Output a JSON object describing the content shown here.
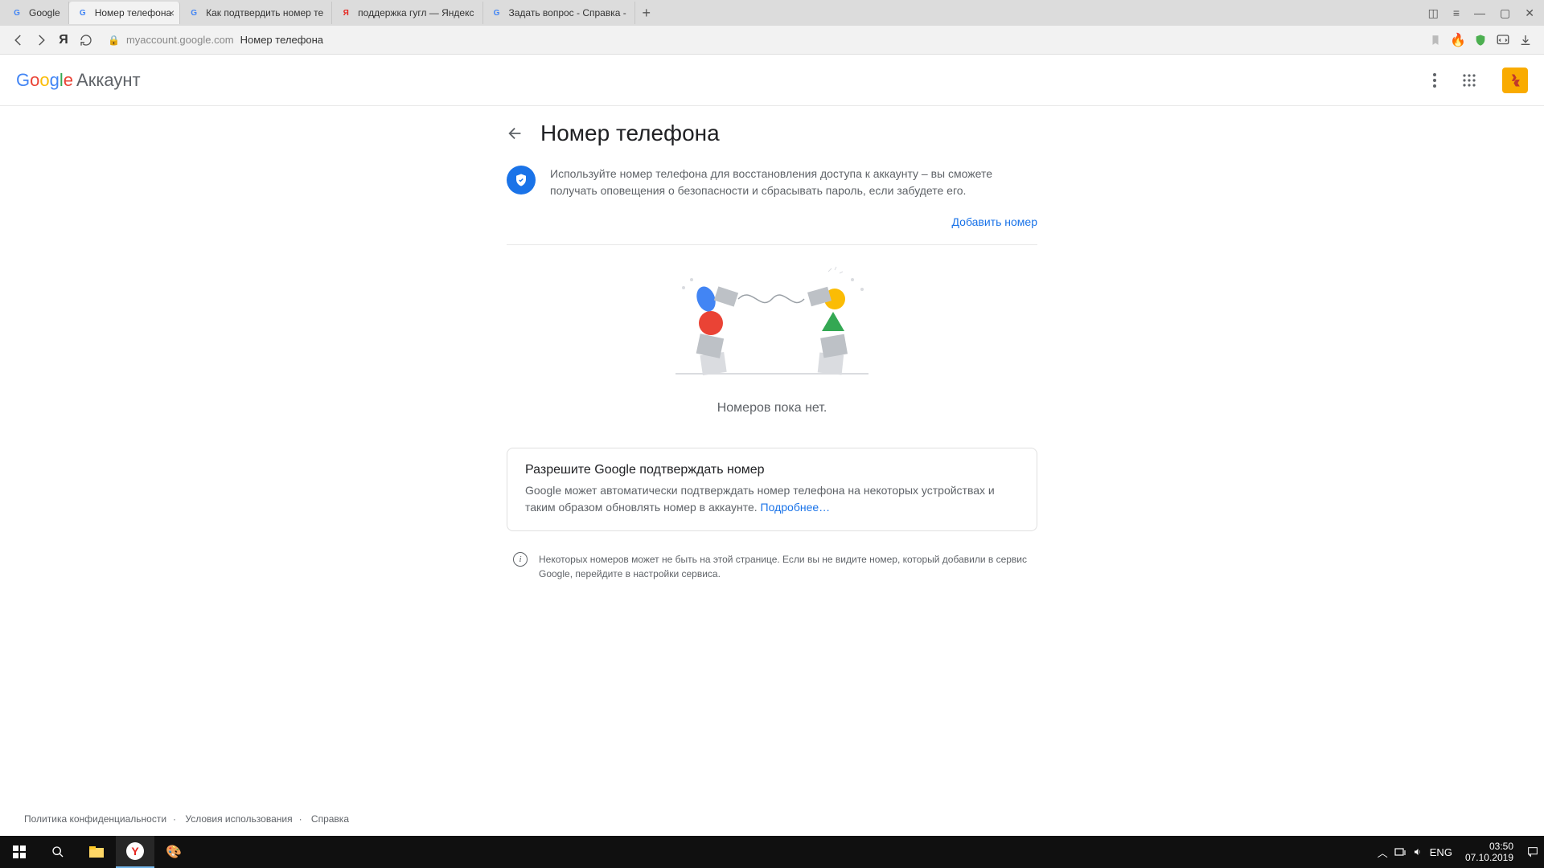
{
  "tabs": [
    {
      "label": "Google",
      "fav": "G"
    },
    {
      "label": "Номер телефона",
      "fav": "G"
    },
    {
      "label": "Как подтвердить номер те",
      "fav": "G"
    },
    {
      "label": "поддержка гугл — Яндекс",
      "fav": "Я"
    },
    {
      "label": "Задать вопрос - Справка -",
      "fav": "G"
    }
  ],
  "address": {
    "domain": "myaccount.google.com",
    "title": "Номер телефона"
  },
  "header": {
    "logo_account": "Аккаунт"
  },
  "page": {
    "title": "Номер телефона",
    "info": "Используйте номер телефона для восстановления доступа к аккаунту – вы сможете получать оповещения о безопасности и сбрасывать пароль, если забудете его.",
    "add_link": "Добавить номер",
    "empty": "Номеров пока нет.",
    "card_title": "Разрешите Google подтверждать номер",
    "card_body": "Google может автоматически подтверждать номер телефона на некоторых устройствах и таким образом обновлять номер в аккаунте. ",
    "card_link": "Подробнее…",
    "note": "Некоторых номеров может не быть на этой странице. Если вы не видите номер, который добавили в сервис Google, перейдите в настройки сервиса."
  },
  "footer": {
    "privacy": "Политика конфиденциальности",
    "terms": "Условия использования",
    "help": "Справка"
  },
  "taskbar": {
    "lang": "ENG",
    "time": "03:50",
    "date": "07.10.2019"
  }
}
